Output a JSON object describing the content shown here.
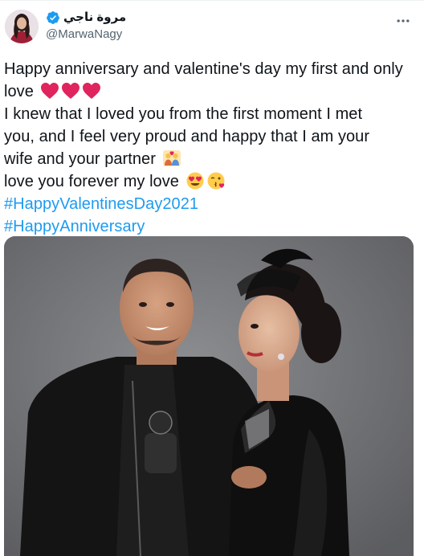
{
  "author": {
    "display_name": "مروة ناجي",
    "handle": "@MarwaNagy"
  },
  "tweet": {
    "line1": "Happy anniversary and valentine's day my first and only",
    "line2": "love",
    "line3": "I knew that I loved you from the first moment I met",
    "line4": "you, and I feel very proud and happy that I am your",
    "line5": "wife and your partner",
    "line6": "love you forever my love",
    "hashtags": [
      "#HappyValentinesDay2021",
      "#HappyAnniversary"
    ]
  },
  "icons": {
    "verified": "verified-badge-icon",
    "more": "more-options-icon",
    "hearts": "red-heart-emoji",
    "couple": "couple-with-heart-emoji",
    "heart_eyes": "heart-eyes-emoji",
    "kiss": "face-blowing-kiss-emoji"
  },
  "colors": {
    "hashtag": "#1d9bf0",
    "verified": "#1d9bf0",
    "handle": "#536471",
    "text": "#0f1419",
    "heart": "#e0245e"
  }
}
